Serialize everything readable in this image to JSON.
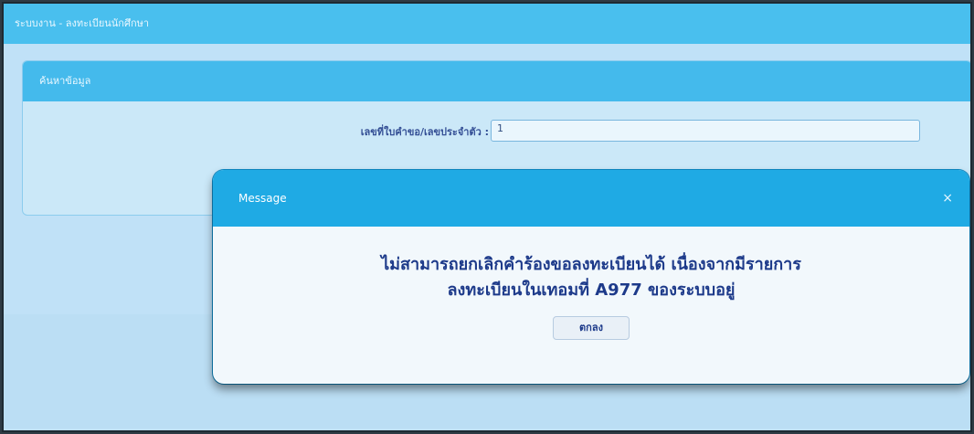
{
  "app": {
    "title": "ระบบงาน - ลงทะเบียนนักศึกษา"
  },
  "panel": {
    "title": "ค้นหาข้อมูล"
  },
  "form": {
    "label": "เลขที่ใบคำขอ/เลขประจำตัว :",
    "value": "1"
  },
  "modal": {
    "title": "Message",
    "close_label": "×",
    "message_line1": "ไม่สามารถยกเลิกคำร้องขอลงทะเบียนได้ เนื่องจากมีรายการ",
    "message_line2": "ลงทะเบียนในเทอมที่ A977 ของระบบอยู่",
    "ok_label": "ตกลง"
  }
}
